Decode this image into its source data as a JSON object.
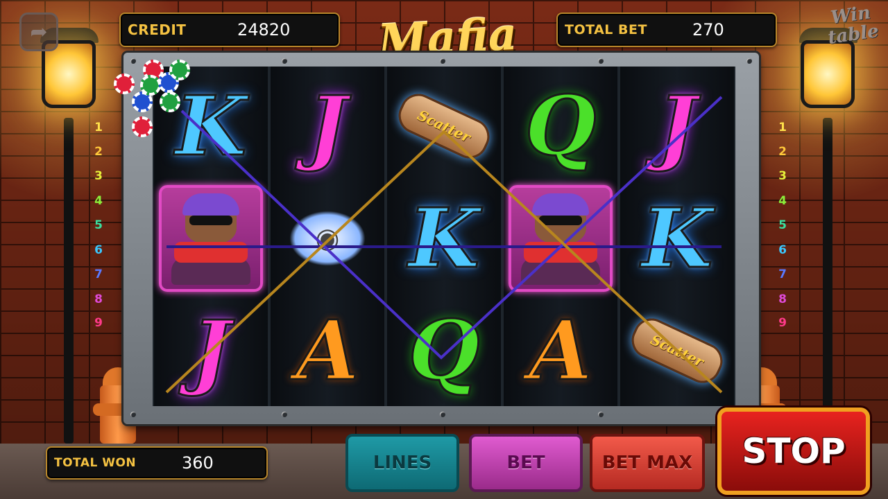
{
  "header": {
    "credit_label": "CREDIT",
    "credit_value": "24820",
    "total_bet_label": "TOTAL BET",
    "total_bet_value": "270",
    "game_title": "Mafia",
    "brand_logo": "Win table"
  },
  "footer": {
    "total_won_label": "TOTAL WON",
    "total_won_value": "360",
    "lines_button": "LINES",
    "bet_button": "BET",
    "bet_max_button": "BET MAX",
    "stop_button": "STOP"
  },
  "line_numbers": [
    "1",
    "2",
    "3",
    "4",
    "5",
    "6",
    "7",
    "8",
    "9"
  ],
  "line_number_colors": [
    "#ffe14a",
    "#ffc83a",
    "#e6f03a",
    "#8aef3a",
    "#3ae0a0",
    "#3ac8ff",
    "#5a7aff",
    "#e04ad8",
    "#ff3a8a"
  ],
  "reels": [
    [
      "K",
      "bandit",
      "J"
    ],
    [
      "J",
      "knuckles",
      "A"
    ],
    [
      "scatter",
      "K",
      "Q"
    ],
    [
      "Q",
      "bandit",
      "A"
    ],
    [
      "J",
      "K",
      "scatter"
    ]
  ],
  "scatter_text": "Scatter",
  "active_paylines": 3,
  "payline_colors": [
    "#4a30c8",
    "#b8861e",
    "#2a1a8a"
  ],
  "icons": {
    "back": "back-arrow-icon",
    "chips": "casino-chips-icon"
  }
}
